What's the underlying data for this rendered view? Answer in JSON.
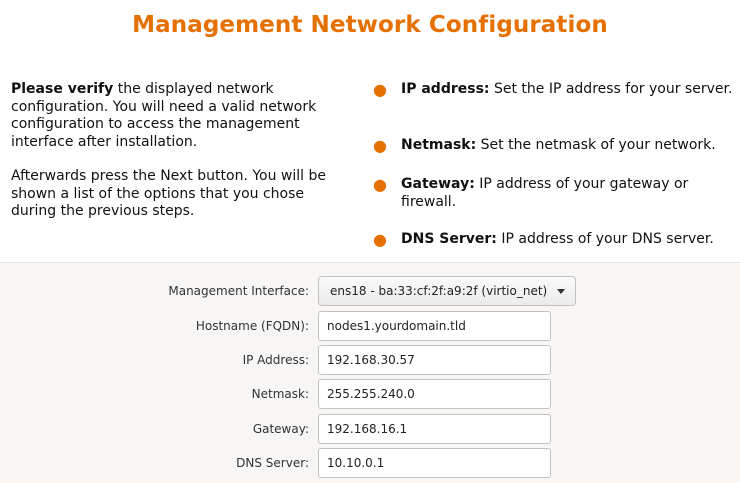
{
  "page": {
    "title": "Management Network Configuration"
  },
  "intro": {
    "p1_bold": "Please verify",
    "p1_rest": " the displayed network configuration. You will need a valid network configuration to access the management interface after installation.",
    "p2": "Afterwards press the Next button. You will be shown a list of the options that you chose during the previous steps."
  },
  "bullets": [
    {
      "label": "IP address:",
      "text": " Set the IP address for your server."
    },
    {
      "label": "Netmask:",
      "text": " Set the netmask of your network."
    },
    {
      "label": "Gateway:",
      "text": " IP address of your gateway or firewall."
    },
    {
      "label": "DNS Server:",
      "text": " IP address of your DNS server."
    }
  ],
  "form": {
    "management_interface": {
      "label": "Management Interface:",
      "value": "ens18 - ba:33:cf:2f:a9:2f (virtio_net)"
    },
    "hostname": {
      "label": "Hostname (FQDN):",
      "value": "nodes1.yourdomain.tld"
    },
    "ip_address": {
      "label": "IP Address:",
      "value": "192.168.30.57"
    },
    "netmask": {
      "label": "Netmask:",
      "value": "255.255.240.0"
    },
    "gateway": {
      "label": "Gateway:",
      "value": "192.168.16.1"
    },
    "dns_server": {
      "label": "DNS Server:",
      "value": "10.10.0.1"
    }
  },
  "colors": {
    "accent": "#e57000",
    "form_background": "#f7f6f5"
  },
  "icons": {
    "bullet": "orange-bullet-dot",
    "dropdown": "chevron-down-icon"
  }
}
